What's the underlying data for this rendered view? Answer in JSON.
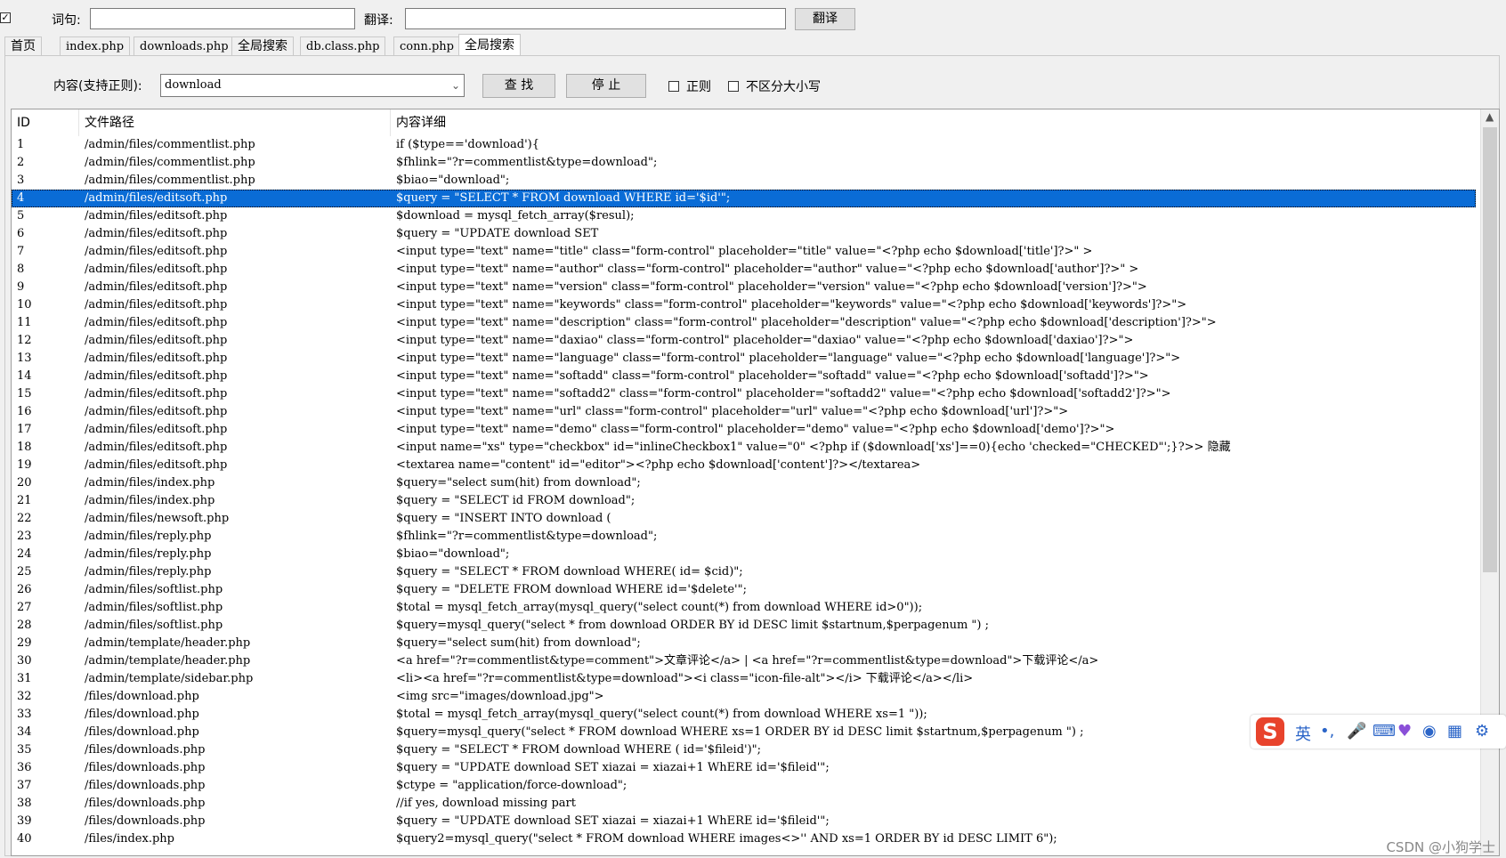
{
  "toolbar": {
    "word_label": "词句:",
    "word_value": "",
    "translate_label": "翻译:",
    "translate_value": "",
    "translate_button": "翻译"
  },
  "tabs": [
    "首页",
    "index.php",
    "downloads.php",
    "全局搜索",
    "db.class.php",
    "conn.php",
    "全局搜索"
  ],
  "active_tab": 6,
  "search": {
    "content_label": "内容(支持正则):",
    "content_value": "download",
    "find_button": "查 找",
    "stop_button": "停 止",
    "regex_label": "正则",
    "regex_checked": false,
    "ignore_case_label": "不区分大小写",
    "ignore_case_checked": false
  },
  "table": {
    "columns": [
      "ID",
      "文件路径",
      "内容详细"
    ],
    "selected_index": 3,
    "rows": [
      [
        "1",
        "/admin/files/commentlist.php",
        "if ($type=='download'){"
      ],
      [
        "2",
        "/admin/files/commentlist.php",
        "$fhlink=\"?r=commentlist&type=download\";"
      ],
      [
        "3",
        "/admin/files/commentlist.php",
        "$biao=\"download\";"
      ],
      [
        "4",
        "/admin/files/editsoft.php",
        "$query = \"SELECT * FROM download WHERE id='$id'\";"
      ],
      [
        "5",
        "/admin/files/editsoft.php",
        "$download = mysql_fetch_array($resul);"
      ],
      [
        "6",
        "/admin/files/editsoft.php",
        "$query = \"UPDATE download SET"
      ],
      [
        "7",
        "/admin/files/editsoft.php",
        "<input type=\"text\" name=\"title\" class=\"form-control\" placeholder=\"title\" value=\"<?php echo $download['title']?>\" >"
      ],
      [
        "8",
        "/admin/files/editsoft.php",
        "<input type=\"text\" name=\"author\" class=\"form-control\" placeholder=\"author\" value=\"<?php echo $download['author']?>\" >"
      ],
      [
        "9",
        "/admin/files/editsoft.php",
        "<input type=\"text\" name=\"version\" class=\"form-control\" placeholder=\"version\" value=\"<?php echo $download['version']?>\">"
      ],
      [
        "10",
        "/admin/files/editsoft.php",
        "<input type=\"text\" name=\"keywords\" class=\"form-control\" placeholder=\"keywords\" value=\"<?php echo $download['keywords']?>\">"
      ],
      [
        "11",
        "/admin/files/editsoft.php",
        "<input type=\"text\" name=\"description\" class=\"form-control\" placeholder=\"description\" value=\"<?php echo $download['description']?>\">"
      ],
      [
        "12",
        "/admin/files/editsoft.php",
        "<input type=\"text\" name=\"daxiao\" class=\"form-control\" placeholder=\"daxiao\" value=\"<?php echo $download['daxiao']?>\">"
      ],
      [
        "13",
        "/admin/files/editsoft.php",
        "<input type=\"text\" name=\"language\" class=\"form-control\" placeholder=\"language\" value=\"<?php echo $download['language']?>\">"
      ],
      [
        "14",
        "/admin/files/editsoft.php",
        "<input type=\"text\" name=\"softadd\" class=\"form-control\" placeholder=\"softadd\" value=\"<?php echo $download['softadd']?>\">"
      ],
      [
        "15",
        "/admin/files/editsoft.php",
        "<input type=\"text\" name=\"softadd2\" class=\"form-control\" placeholder=\"softadd2\" value=\"<?php echo $download['softadd2']?>\">"
      ],
      [
        "16",
        "/admin/files/editsoft.php",
        "<input type=\"text\" name=\"url\" class=\"form-control\" placeholder=\"url\" value=\"<?php echo $download['url']?>\">"
      ],
      [
        "17",
        "/admin/files/editsoft.php",
        "<input type=\"text\" name=\"demo\" class=\"form-control\" placeholder=\"demo\" value=\"<?php echo $download['demo']?>\">"
      ],
      [
        "18",
        "/admin/files/editsoft.php",
        "<input name=\"xs\" type=\"checkbox\" id=\"inlineCheckbox1\" value=\"0\" <?php if ($download['xs']==0){echo 'checked=\"CHECKED\"';}?>> 隐藏"
      ],
      [
        "19",
        "/admin/files/editsoft.php",
        "<textarea name=\"content\" id=\"editor\"><?php echo $download['content']?></textarea>"
      ],
      [
        "20",
        "/admin/files/index.php",
        "$query=\"select sum(hit) from download\";"
      ],
      [
        "21",
        "/admin/files/index.php",
        "$query = \"SELECT id FROM download\";"
      ],
      [
        "22",
        "/admin/files/newsoft.php",
        "$query = \"INSERT INTO download ("
      ],
      [
        "23",
        "/admin/files/reply.php",
        "$fhlink=\"?r=commentlist&type=download\";"
      ],
      [
        "24",
        "/admin/files/reply.php",
        "$biao=\"download\";"
      ],
      [
        "25",
        "/admin/files/reply.php",
        "$query = \"SELECT * FROM download WHERE( id= $cid)\";"
      ],
      [
        "26",
        "/admin/files/softlist.php",
        "$query = \"DELETE FROM download WHERE id='$delete'\";"
      ],
      [
        "27",
        "/admin/files/softlist.php",
        "$total = mysql_fetch_array(mysql_query(\"select count(*) from download WHERE id>0\"));"
      ],
      [
        "28",
        "/admin/files/softlist.php",
        "$query=mysql_query(\"select * from download ORDER BY id DESC limit $startnum,$perpagenum \") ;"
      ],
      [
        "29",
        "/admin/template/header.php",
        "$query=\"select sum(hit) from download\";"
      ],
      [
        "30",
        "/admin/template/header.php",
        "<a href=\"?r=commentlist&type=comment\">文章评论</a> | <a href=\"?r=commentlist&type=download\">下载评论</a>"
      ],
      [
        "31",
        "/admin/template/sidebar.php",
        "<li><a href=\"?r=commentlist&type=download\"><i class=\"icon-file-alt\"></i> 下载评论</a></li>"
      ],
      [
        "32",
        "/files/download.php",
        "<img src=\"images/download.jpg\">"
      ],
      [
        "33",
        "/files/download.php",
        "$total = mysql_fetch_array(mysql_query(\"select count(*) from download WHERE xs=1 \"));"
      ],
      [
        "34",
        "/files/download.php",
        "$query=mysql_query(\"select * FROM download WHERE xs=1 ORDER BY id DESC limit $startnum,$perpagenum \") ;"
      ],
      [
        "35",
        "/files/downloads.php",
        "$query = \"SELECT * FROM download WHERE ( id='$fileid')\";"
      ],
      [
        "36",
        "/files/downloads.php",
        "$query = \"UPDATE download SET xiazai = xiazai+1 WhERE id='$fileid'\";"
      ],
      [
        "37",
        "/files/downloads.php",
        "$ctype = \"application/force-download\";"
      ],
      [
        "38",
        "/files/downloads.php",
        "//if yes, download missing part"
      ],
      [
        "39",
        "/files/downloads.php",
        "$query = \"UPDATE download SET xiazai = xiazai+1 WhERE id='$fileid'\";"
      ],
      [
        "40",
        "/files/index.php",
        "$query2=mysql_query(\"select * FROM download WHERE images<>'' AND xs=1 ORDER BY id DESC  LIMIT 6\");"
      ]
    ]
  },
  "ime": {
    "logo": "S",
    "mode": "英",
    "punct": "•,"
  },
  "watermark": "CSDN @小狗学士"
}
